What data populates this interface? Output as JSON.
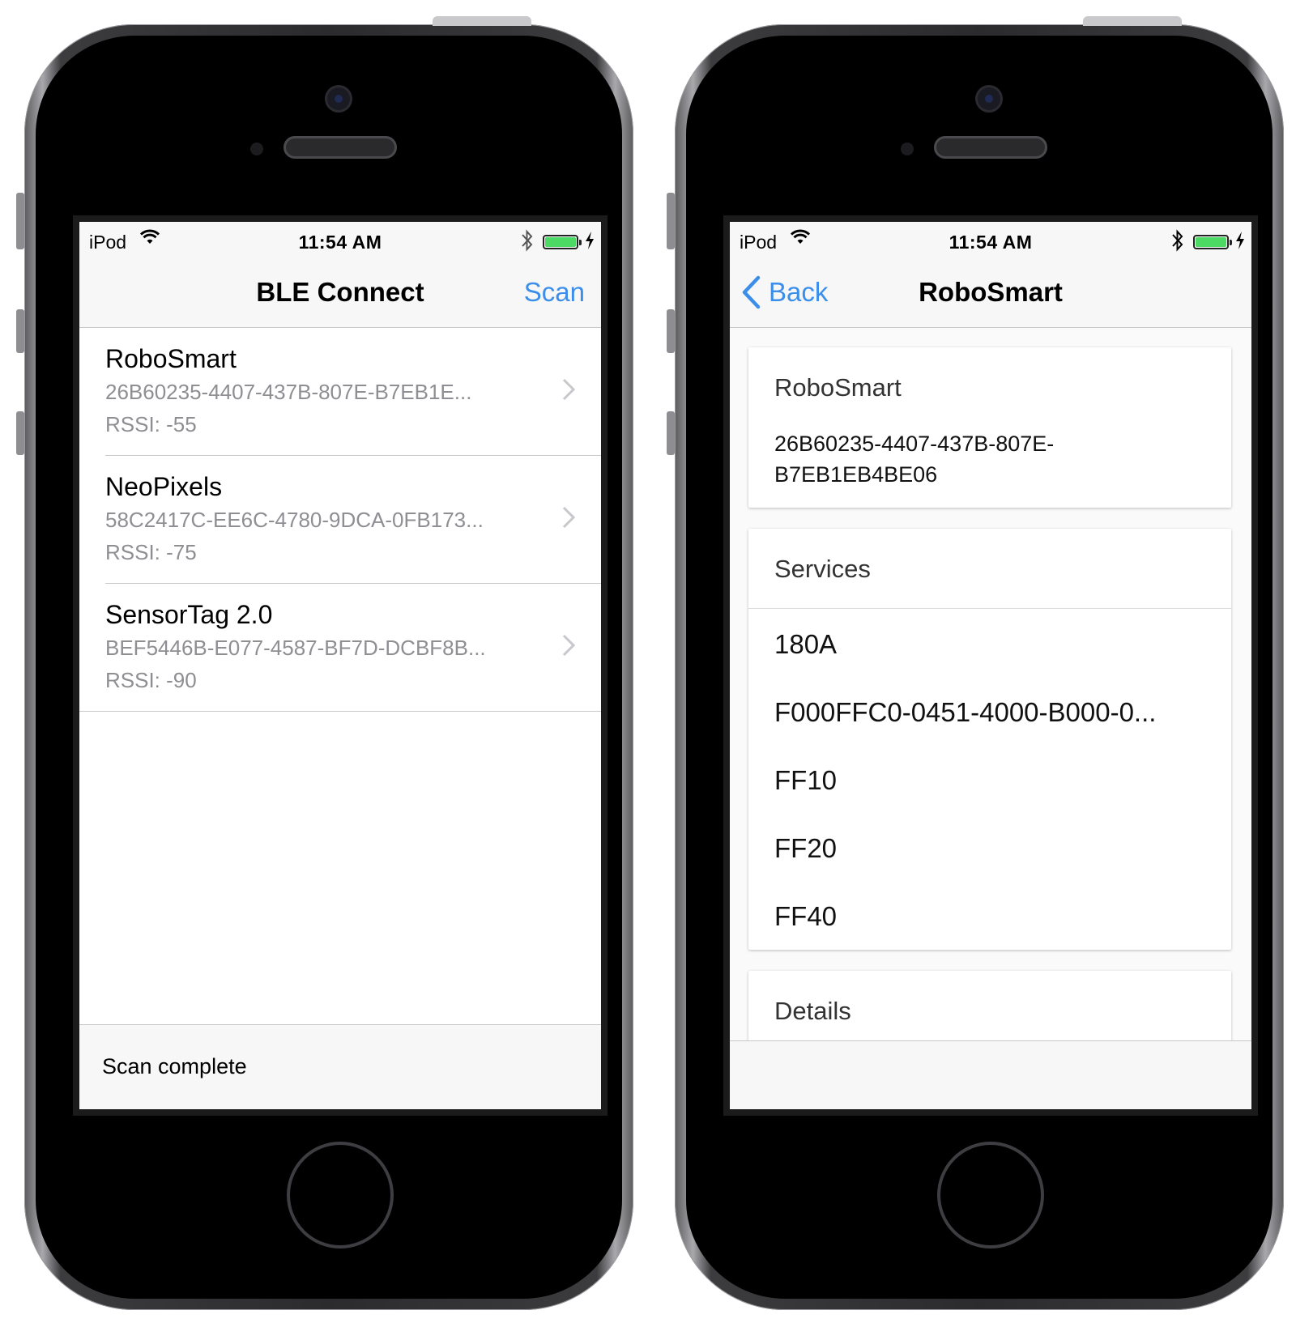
{
  "left_phone": {
    "status_bar": {
      "carrier": "iPod",
      "time": "11:54 AM"
    },
    "nav": {
      "title": "BLE Connect",
      "scan_label": "Scan"
    },
    "devices": [
      {
        "name": "RoboSmart",
        "uuid": "26B60235-4407-437B-807E-B7EB1E...",
        "rssi": "RSSI: -55"
      },
      {
        "name": "NeoPixels",
        "uuid": "58C2417C-EE6C-4780-9DCA-0FB173...",
        "rssi": "RSSI: -75"
      },
      {
        "name": "SensorTag 2.0",
        "uuid": "BEF5446B-E077-4587-BF7D-DCBF8B...",
        "rssi": "RSSI: -90"
      }
    ],
    "footer": {
      "status": "Scan complete"
    }
  },
  "right_phone": {
    "status_bar": {
      "carrier": "iPod",
      "time": "11:54 AM"
    },
    "nav": {
      "back_label": "Back",
      "title": "RoboSmart"
    },
    "device_card": {
      "name": "RoboSmart",
      "uuid_line1": "26B60235-4407-437B-807E-",
      "uuid_line2": "B7EB1EB4BE06"
    },
    "services_card": {
      "header": "Services",
      "items": [
        "180A",
        "F000FFC0-0451-4000-B000-0...",
        "FF10",
        "FF20",
        "FF40"
      ]
    },
    "details_card": {
      "header": "Details"
    }
  },
  "colors": {
    "accent": "#3b8eea",
    "battery": "#4cd964",
    "secondary_text": "#8e8e93",
    "bar_background": "#f7f7f7"
  },
  "icons": [
    "wifi-icon",
    "bluetooth-icon",
    "battery-icon",
    "charging-bolt-icon",
    "chevron-right-icon",
    "chevron-left-icon"
  ]
}
